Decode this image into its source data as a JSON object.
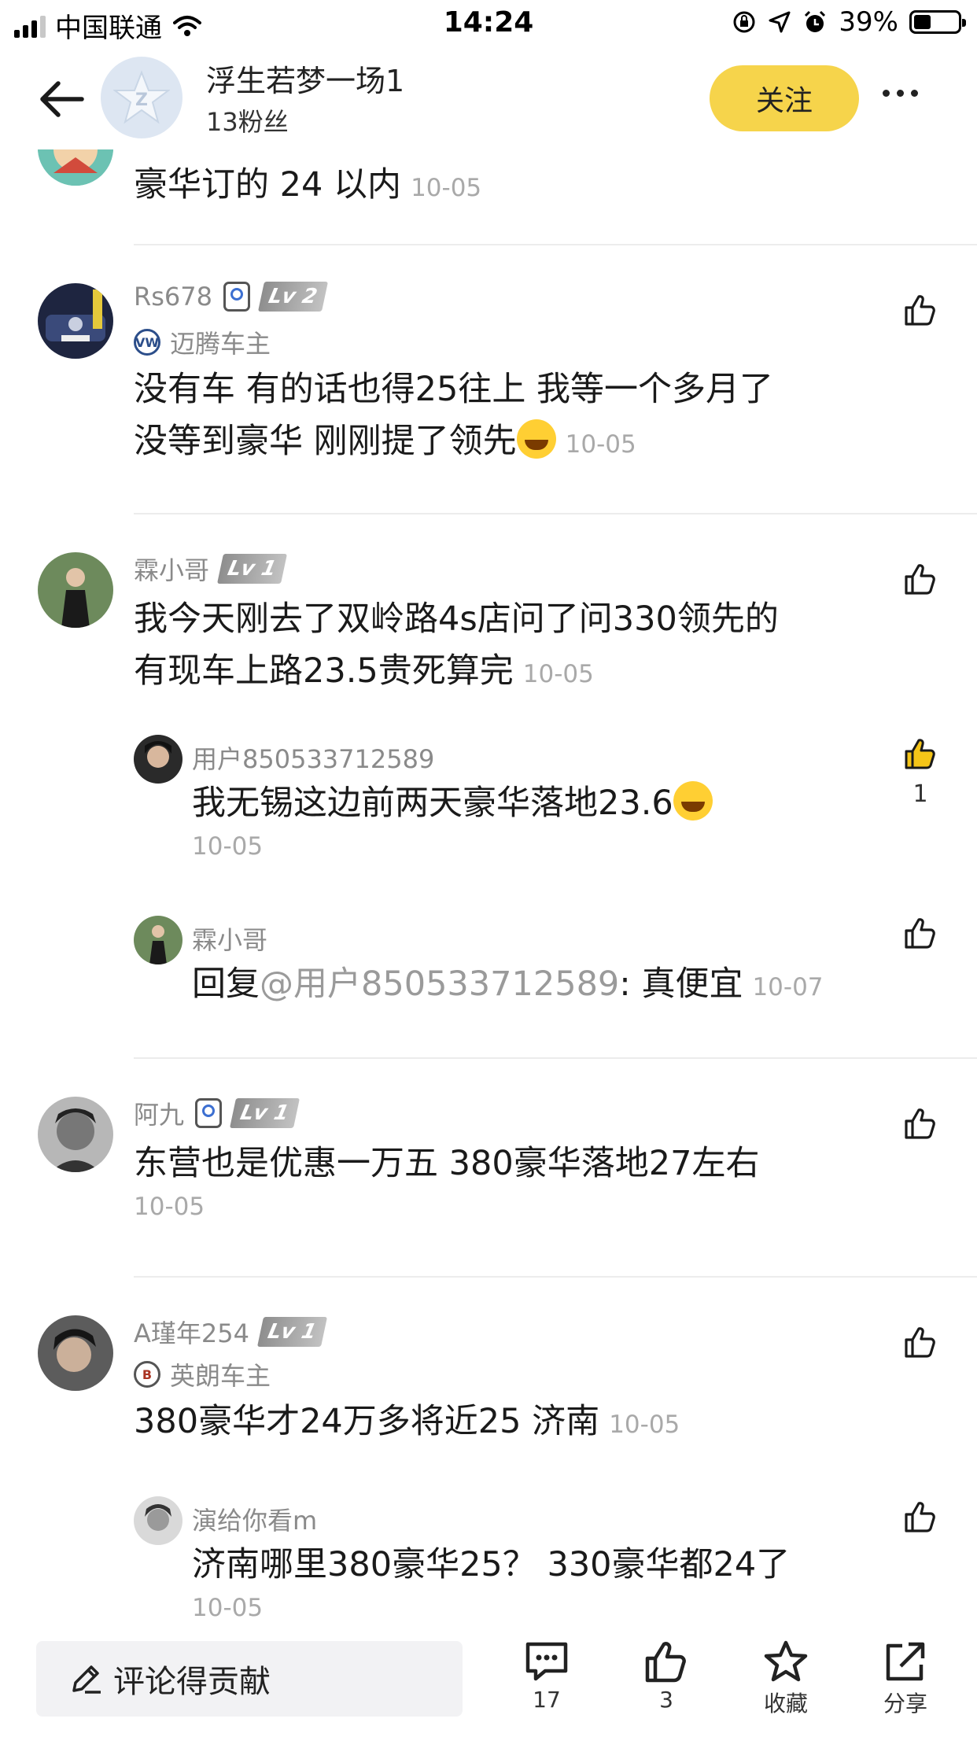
{
  "status_bar": {
    "carrier": "中国联通",
    "time": "14:24",
    "battery": "39%",
    "battery_level": 0.39
  },
  "header": {
    "username": "浮生若梦一场1",
    "fans": "13粉丝",
    "follow_label": "关注"
  },
  "comments": [
    {
      "text": "豪华订的 24 以内",
      "date": "10-05"
    },
    {
      "username": "Rs678",
      "level": "Lv 2",
      "owner": "迈腾车主",
      "line1": "没有车 有的话也得25往上 我等一个多月了",
      "line2": "没等到豪华 刚刚提了领先",
      "date": "10-05"
    },
    {
      "username": "霖小哥",
      "level": "Lv 1",
      "line1": "我今天刚去了双岭路4s店问了问330领先的",
      "line2": "有现车上路23.5贵死算完",
      "date": "10-05",
      "replies": [
        {
          "username": "用户850533712589",
          "text": "我无锡这边前两天豪华落地23.6",
          "date": "10-05",
          "likes": "1"
        },
        {
          "username": "霖小哥",
          "prefix": "回复",
          "mention": "@用户850533712589",
          "text": ": 真便宜",
          "date": "10-07"
        }
      ]
    },
    {
      "username": "阿九",
      "level": "Lv 1",
      "text": "东营也是优惠一万五 380豪华落地27左右",
      "date": "10-05"
    },
    {
      "username": "A瑾年254",
      "level": "Lv 1",
      "owner": "英朗车主",
      "text": "380豪华才24万多将近25 济南",
      "date": "10-05",
      "replies": [
        {
          "username": "演给你看m",
          "text": "济南哪里380豪华25？ 330豪华都24了",
          "date": "10-05"
        }
      ]
    }
  ],
  "bottom_bar": {
    "comment_placeholder": "评论得贡献",
    "comment_count": "17",
    "like_count": "3",
    "favorite_label": "收藏",
    "share_label": "分享"
  },
  "colors": {
    "accent_yellow": "#F6D44B",
    "liked_yellow": "#F5C518",
    "meta_gray": "#8A8A8A"
  }
}
